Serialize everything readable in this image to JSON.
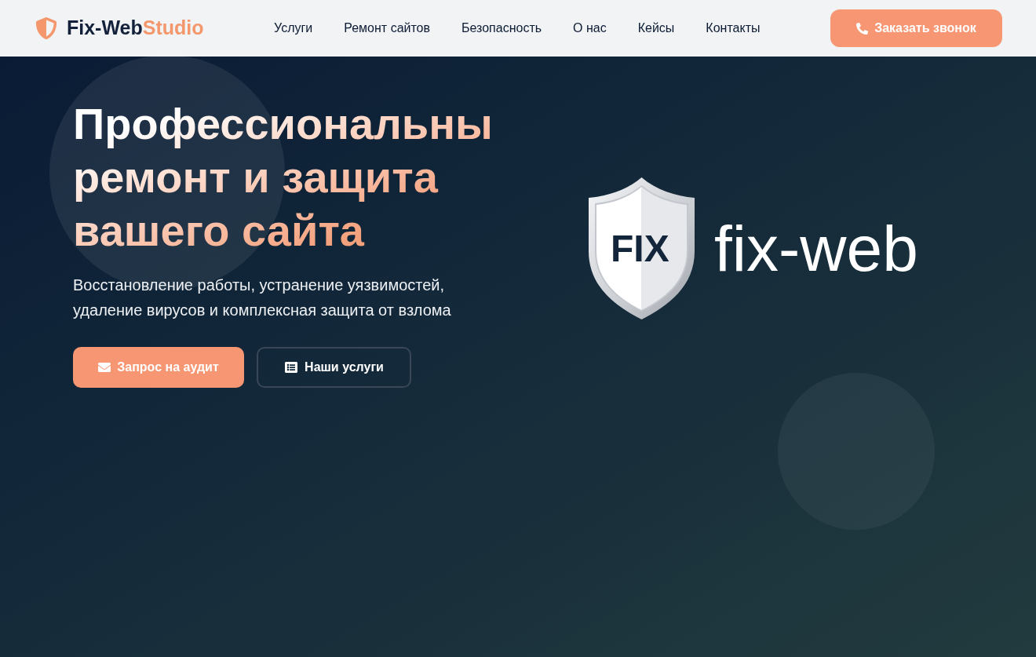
{
  "header": {
    "brand": {
      "name": "Fix-Web",
      "accent": "Studio"
    },
    "nav": [
      "Услуги",
      "Ремонт сайтов",
      "Безопасность",
      "О нас",
      "Кейсы",
      "Контакты"
    ],
    "cta": {
      "label": "Заказать звонок"
    }
  },
  "hero": {
    "title": "Профессиональны ремонт и защита вашего сайта",
    "subtitle": "Восстановление работы, устранение уязвимостей, удаление вирусов и комплексная защита от взлома",
    "buttons": [
      {
        "kind": "primary",
        "label": "Запрос на аудит"
      },
      {
        "kind": "outline",
        "label": "Наши услуги"
      }
    ],
    "logo": {
      "badge": "FIX",
      "wordmark": "fix-web"
    }
  }
}
